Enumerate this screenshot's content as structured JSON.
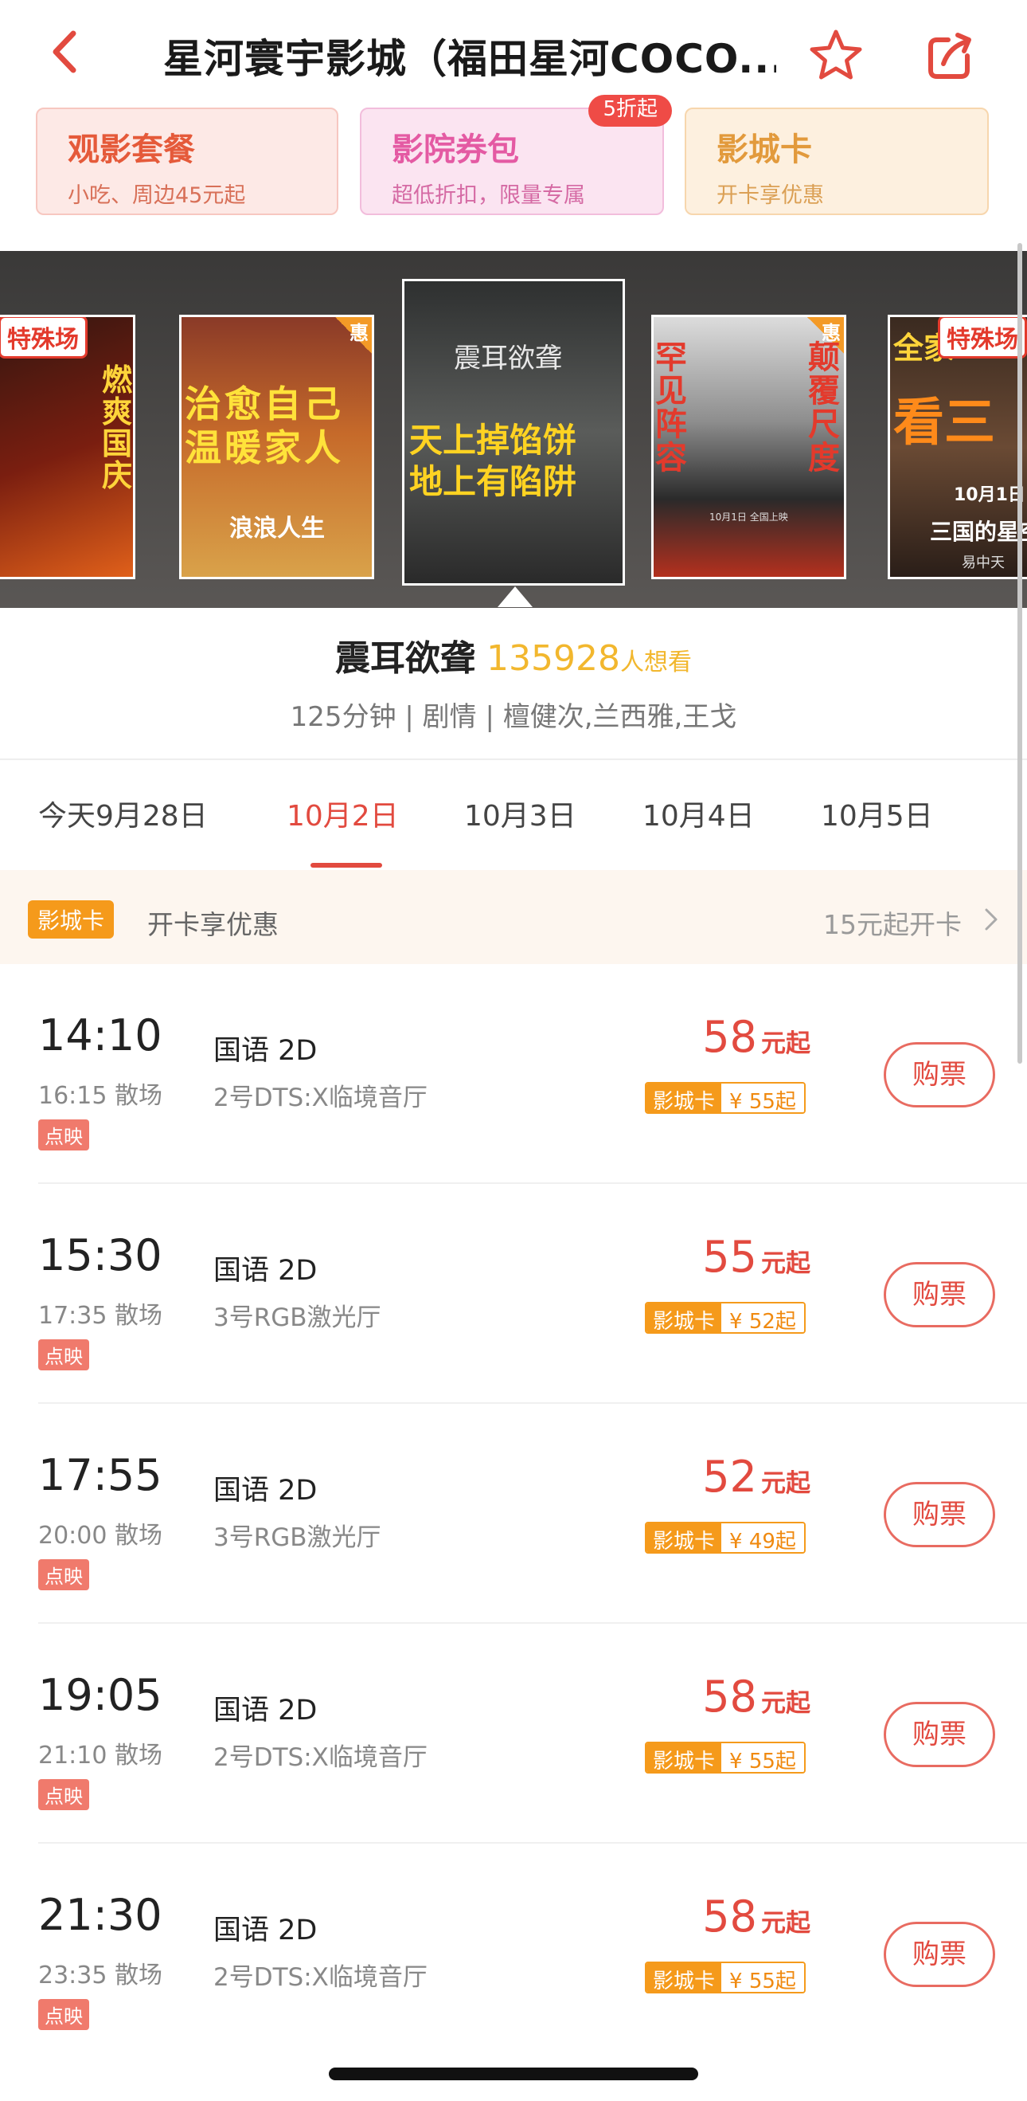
{
  "header": {
    "title": "星河寰宇影城（福田星河COCO...",
    "back_icon": "chevron-left-icon",
    "favorite_icon": "star-icon",
    "share_icon": "share-icon"
  },
  "promos": [
    {
      "title": "观影套餐",
      "subtitle": "小吃、周边45元起"
    },
    {
      "title": "影院券包",
      "subtitle": "超低折扣，限量专属",
      "badge": "5折起"
    },
    {
      "title": "影城卡",
      "subtitle": "开卡享优惠"
    }
  ],
  "posters": [
    {
      "tag": "特殊场",
      "text": "燃爽国庆"
    },
    {
      "text1": "治愈自己",
      "text2": "温暖家人",
      "extra": "浪浪人生",
      "hui": "惠"
    },
    {
      "title": "震耳欲聋",
      "text1": "天上掉馅饼",
      "text2": "地上有陷阱"
    },
    {
      "text1": "罕见阵容",
      "text2": "颠覆尺度",
      "hui": "惠",
      "small": "10月1日 全国上映"
    },
    {
      "tag": "特殊场",
      "text": "看三",
      "top": "全家一",
      "date": "10月1日",
      "sub": "三国的星空",
      "small": "易中天"
    }
  ],
  "movie": {
    "name": "震耳欲聋",
    "want_count": "135928",
    "want_label": "人想看",
    "meta": "125分钟 | 剧情 | 檀健次,兰西雅,王戈"
  },
  "date_tabs": [
    {
      "label": "今天9月28日"
    },
    {
      "label": "10月2日"
    },
    {
      "label": "10月3日"
    },
    {
      "label": "10月4日"
    },
    {
      "label": "10月5日"
    }
  ],
  "card_banner": {
    "tag": "影城卡",
    "text": "开卡享优惠",
    "right": "15元起开卡"
  },
  "showtimes": [
    {
      "start": "14:10",
      "end": "16:15 散场",
      "tag": "点映",
      "lang": "国语 2D",
      "hall": "2号DTS:X临境音厅",
      "price": "58",
      "unit": "元起",
      "card_label": "影城卡",
      "card_price": "¥ 55起",
      "buy": "购票"
    },
    {
      "start": "15:30",
      "end": "17:35 散场",
      "tag": "点映",
      "lang": "国语 2D",
      "hall": "3号RGB激光厅",
      "price": "55",
      "unit": "元起",
      "card_label": "影城卡",
      "card_price": "¥ 52起",
      "buy": "购票"
    },
    {
      "start": "17:55",
      "end": "20:00 散场",
      "tag": "点映",
      "lang": "国语 2D",
      "hall": "3号RGB激光厅",
      "price": "52",
      "unit": "元起",
      "card_label": "影城卡",
      "card_price": "¥ 49起",
      "buy": "购票"
    },
    {
      "start": "19:05",
      "end": "21:10 散场",
      "tag": "点映",
      "lang": "国语 2D",
      "hall": "2号DTS:X临境音厅",
      "price": "58",
      "unit": "元起",
      "card_label": "影城卡",
      "card_price": "¥ 55起",
      "buy": "购票"
    },
    {
      "start": "21:30",
      "end": "23:35 散场",
      "tag": "点映",
      "lang": "国语 2D",
      "hall": "2号DTS:X临境音厅",
      "price": "58",
      "unit": "元起",
      "card_label": "影城卡",
      "card_price": "¥ 55起",
      "buy": "购票"
    }
  ],
  "colors": {
    "accent": "#e24a3f",
    "gold": "#f2b72e",
    "orange": "#f59a1b"
  }
}
